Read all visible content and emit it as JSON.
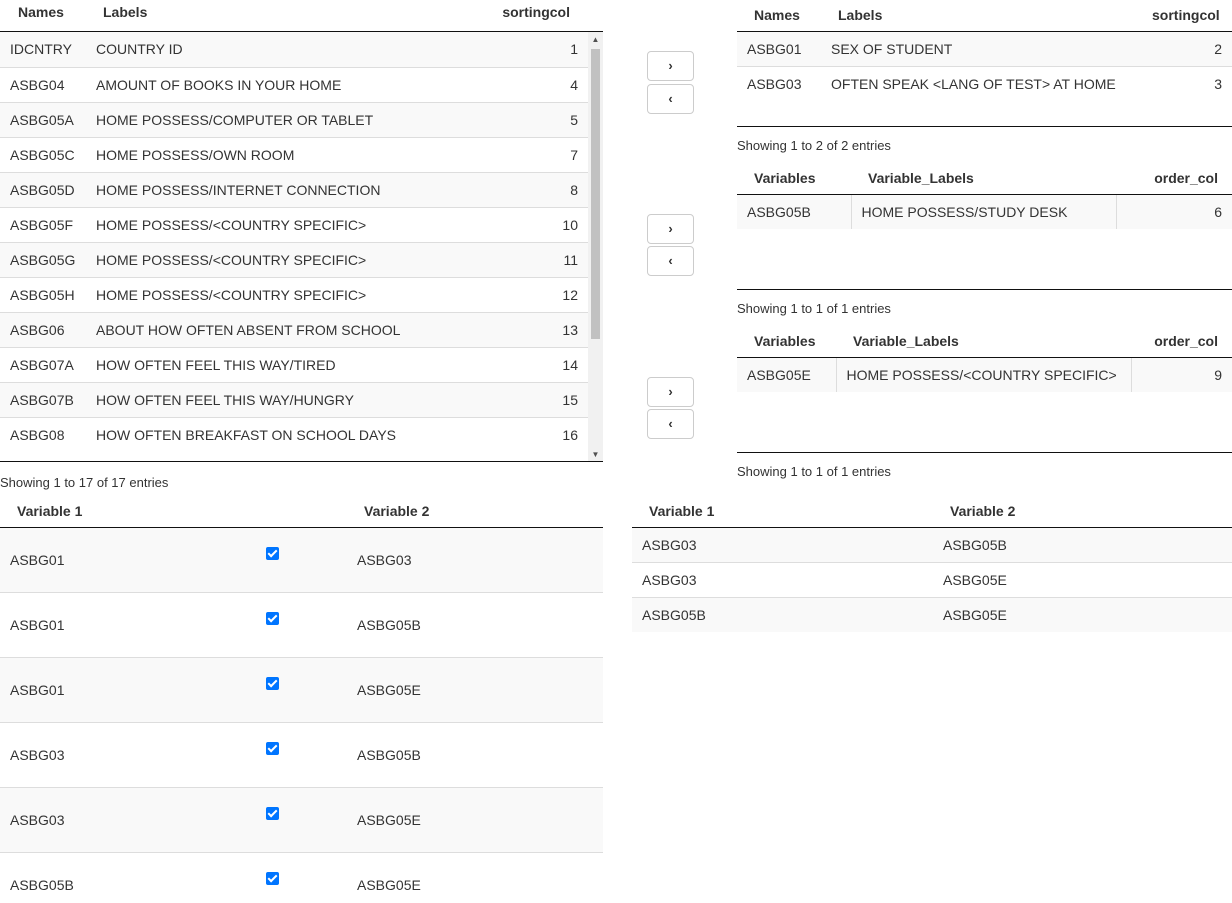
{
  "main_table": {
    "headers": {
      "names": "Names",
      "labels": "Labels",
      "sortingcol": "sortingcol"
    },
    "rows": [
      {
        "name": "IDCNTRY",
        "label": "COUNTRY ID",
        "sort": "1"
      },
      {
        "name": "ASBG04",
        "label": "AMOUNT OF BOOKS IN YOUR HOME",
        "sort": "4"
      },
      {
        "name": "ASBG05A",
        "label": "HOME POSSESS/COMPUTER OR TABLET",
        "sort": "5"
      },
      {
        "name": "ASBG05C",
        "label": "HOME POSSESS/OWN ROOM",
        "sort": "7"
      },
      {
        "name": "ASBG05D",
        "label": "HOME POSSESS/INTERNET CONNECTION",
        "sort": "8"
      },
      {
        "name": "ASBG05F",
        "label": "HOME POSSESS/<COUNTRY SPECIFIC>",
        "sort": "10"
      },
      {
        "name": "ASBG05G",
        "label": "HOME POSSESS/<COUNTRY SPECIFIC>",
        "sort": "11"
      },
      {
        "name": "ASBG05H",
        "label": "HOME POSSESS/<COUNTRY SPECIFIC>",
        "sort": "12"
      },
      {
        "name": "ASBG06",
        "label": "ABOUT HOW OFTEN ABSENT FROM SCHOOL",
        "sort": "13"
      },
      {
        "name": "ASBG07A",
        "label": "HOW OFTEN FEEL THIS WAY/TIRED",
        "sort": "14"
      },
      {
        "name": "ASBG07B",
        "label": "HOW OFTEN FEEL THIS WAY/HUNGRY",
        "sort": "15"
      },
      {
        "name": "ASBG08",
        "label": "HOW OFTEN BREAKFAST ON SCHOOL DAYS",
        "sort": "16"
      }
    ],
    "info": "Showing 1 to 17 of 17 entries"
  },
  "buttons": {
    "right": "›",
    "left": "‹"
  },
  "table_a": {
    "headers": {
      "names": "Names",
      "labels": "Labels",
      "sortingcol": "sortingcol"
    },
    "rows": [
      {
        "name": "ASBG01",
        "label": "SEX OF STUDENT",
        "sort": "2"
      },
      {
        "name": "ASBG03",
        "label": "OFTEN SPEAK <LANG OF TEST> AT HOME",
        "sort": "3"
      }
    ],
    "info": "Showing 1 to 2 of 2 entries"
  },
  "table_b": {
    "headers": {
      "variables": "Variables",
      "labels": "Variable_Labels",
      "order": "order_col"
    },
    "rows": [
      {
        "name": "ASBG05B",
        "label": "HOME POSSESS/STUDY DESK",
        "sort": "6"
      }
    ],
    "info": "Showing 1 to 1 of 1 entries"
  },
  "table_c": {
    "headers": {
      "variables": "Variables",
      "labels": "Variable_Labels",
      "order": "order_col"
    },
    "rows": [
      {
        "name": "ASBG05E",
        "label": "HOME POSSESS/<COUNTRY SPECIFIC>",
        "sort": "9"
      }
    ],
    "info": "Showing 1 to 1 of 1 entries"
  },
  "selection_table": {
    "headers": {
      "v1": "Variable 1",
      "v2": "Variable 2"
    },
    "rows": [
      {
        "v1": "ASBG01",
        "v2": "ASBG03",
        "checked": true
      },
      {
        "v1": "ASBG01",
        "v2": "ASBG05B",
        "checked": true
      },
      {
        "v1": "ASBG01",
        "v2": "ASBG05E",
        "checked": true
      },
      {
        "v1": "ASBG03",
        "v2": "ASBG05B",
        "checked": true
      },
      {
        "v1": "ASBG03",
        "v2": "ASBG05E",
        "checked": true
      },
      {
        "v1": "ASBG05B",
        "v2": "ASBG05E",
        "checked": true
      }
    ]
  },
  "pair_table": {
    "headers": {
      "v1": "Variable 1",
      "v2": "Variable 2"
    },
    "rows": [
      {
        "v1": "ASBG03",
        "v2": "ASBG05B"
      },
      {
        "v1": "ASBG03",
        "v2": "ASBG05E"
      },
      {
        "v1": "ASBG05B",
        "v2": "ASBG05E"
      }
    ]
  },
  "colors": {
    "checkbox": "#0075ff",
    "stripe": "#f9f9f9",
    "border": "#111111"
  }
}
